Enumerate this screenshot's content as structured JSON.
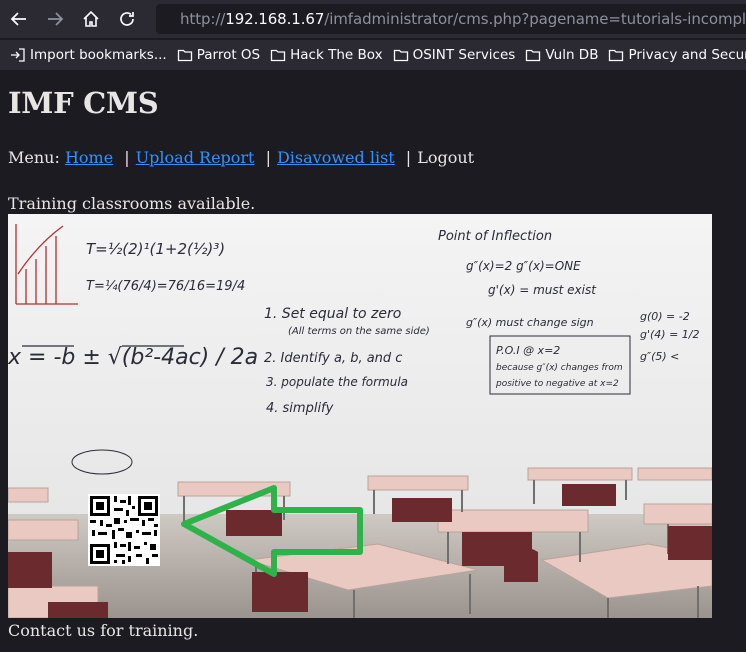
{
  "browser": {
    "url_prefix": "http://",
    "url_host": "192.168.1.67",
    "url_path": "/imfadministrator/cms.php?pagename=tutorials-incomplete",
    "bookmarks": [
      {
        "label": "Import bookmarks...",
        "icon": "import-icon"
      },
      {
        "label": "Parrot OS",
        "icon": "folder-icon"
      },
      {
        "label": "Hack The Box",
        "icon": "folder-icon"
      },
      {
        "label": "OSINT Services",
        "icon": "folder-icon"
      },
      {
        "label": "Vuln DB",
        "icon": "folder-icon"
      },
      {
        "label": "Privacy and Security",
        "icon": "folder-icon"
      }
    ]
  },
  "page": {
    "title": "IMF CMS",
    "menu_prefix": "Menu:",
    "menu": {
      "home": "Home",
      "upload_report": "Upload Report",
      "disavowed_list": "Disavowed list",
      "logout": "Logout",
      "separator": "|"
    },
    "intro": "Training classrooms available.",
    "contact": "Contact us for training."
  },
  "whiteboard": {
    "formula_lines": [
      "T=½(2)¹(1+2(½)³)",
      "T=¼(76/4)=76/16=19/4"
    ],
    "steps": [
      "1. Set equal to zero",
      "(All terms on the same side)",
      "2. Identify a, b, and c",
      "3. populate the formula",
      "4. simplify"
    ],
    "poi_title": "Point of Inflection",
    "poi_lines": [
      "g″(x)=2  g″(x)=ONE",
      "g'(x) = must exist",
      "g″(x) must change sign"
    ],
    "poi_box": [
      "P.O.I @ x=2",
      "because g″(x) changes from",
      "positive to negative at x=2"
    ],
    "quadratic": "x = -b ± √(b²-4ac) / 2a",
    "right_notes": [
      "g(0) = -2",
      "g'(4) = 1/2",
      "g″(5) <"
    ]
  },
  "colors": {
    "arrow": "#2db34a",
    "link": "#3391ff",
    "desk_top": "#e9c9c1",
    "chair": "#6b2a2d"
  }
}
